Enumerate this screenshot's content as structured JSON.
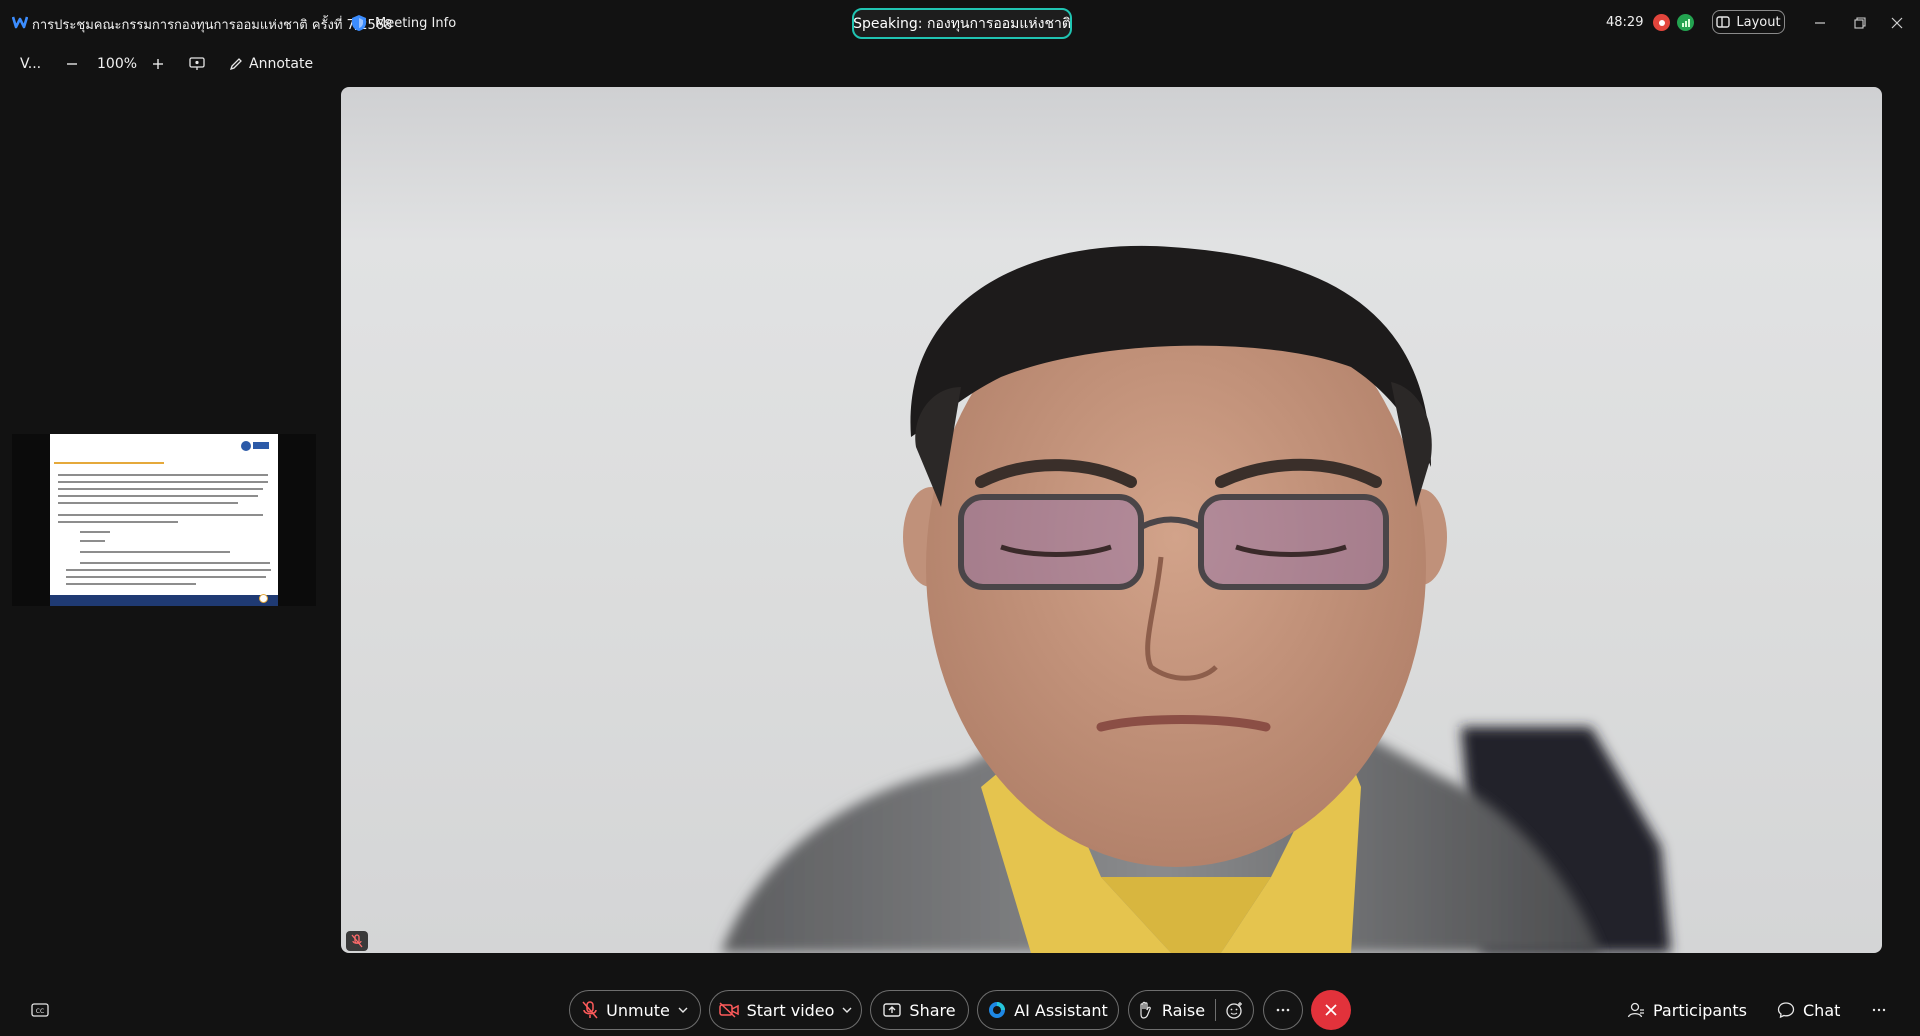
{
  "titlebar": {
    "meeting_title": "การประชุมคณะกรรมการกองทุนการออมแห่งชาติ ครั้งที่ 7/2568",
    "meeting_info_label": "Meeting Info",
    "speaking_label": "Speaking: กองทุนการออมแห่งชาติ",
    "timer": "48:29",
    "layout_label": "Layout"
  },
  "toolbar2": {
    "view_label": "V...",
    "zoom_level": "100%",
    "annotate_label": "Annotate"
  },
  "controls": {
    "unmute_label": "Unmute",
    "start_video_label": "Start video",
    "share_label": "Share",
    "ai_assistant_label": "AI Assistant",
    "raise_label": "Raise",
    "participants_label": "Participants",
    "chat_label": "Chat"
  },
  "colors": {
    "speaking_outline": "#20c4b2",
    "leave_red": "#e2323b",
    "recording_red": "#e2453c",
    "network_green": "#23a350"
  },
  "icons": [
    "webex-logo-icon",
    "shield-icon",
    "record-icon",
    "network-icon",
    "layout-icon",
    "minimize-icon",
    "restore-icon",
    "close-icon",
    "zoom-out-icon",
    "zoom-in-icon",
    "screen-icon",
    "annotate-pen-icon",
    "closed-caption-icon",
    "mic-muted-icon",
    "video-off-icon",
    "chevron-down-icon",
    "share-icon",
    "ai-assistant-icon",
    "raise-hand-icon",
    "reaction-icon",
    "more-icon",
    "leave-icon",
    "participants-icon",
    "chat-icon"
  ]
}
